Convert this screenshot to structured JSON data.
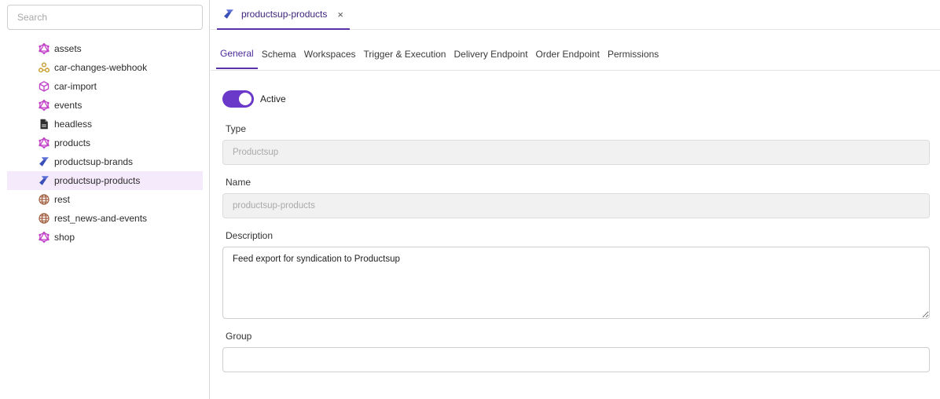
{
  "search": {
    "placeholder": "Search"
  },
  "sidebar": {
    "items": [
      {
        "label": "assets",
        "icon": "graphql-icon",
        "selected": false
      },
      {
        "label": "car-changes-webhook",
        "icon": "webhook-icon",
        "selected": false
      },
      {
        "label": "car-import",
        "icon": "cube-import-icon",
        "selected": false
      },
      {
        "label": "events",
        "icon": "graphql-icon",
        "selected": false
      },
      {
        "label": "headless",
        "icon": "document-icon",
        "selected": false
      },
      {
        "label": "products",
        "icon": "graphql-icon",
        "selected": false
      },
      {
        "label": "productsup-brands",
        "icon": "productsup-icon",
        "selected": false
      },
      {
        "label": "productsup-products",
        "icon": "productsup-icon",
        "selected": true
      },
      {
        "label": "rest",
        "icon": "globe-icon",
        "selected": false
      },
      {
        "label": "rest_news-and-events",
        "icon": "globe-icon",
        "selected": false
      },
      {
        "label": "shop",
        "icon": "graphql-icon",
        "selected": false
      }
    ]
  },
  "doc_tab": {
    "label": "productsup-products",
    "close_symbol": "×",
    "icon": "productsup-icon"
  },
  "tabs": [
    {
      "label": "General",
      "active": true
    },
    {
      "label": "Schema",
      "active": false
    },
    {
      "label": "Workspaces",
      "active": false
    },
    {
      "label": "Trigger & Execution",
      "active": false
    },
    {
      "label": "Delivery Endpoint",
      "active": false
    },
    {
      "label": "Order Endpoint",
      "active": false
    },
    {
      "label": "Permissions",
      "active": false
    }
  ],
  "form": {
    "active_label": "Active",
    "active_on": true,
    "type_label": "Type",
    "type_value": "Productsup",
    "name_label": "Name",
    "name_value": "productsup-products",
    "description_label": "Description",
    "description_value": "Feed export for syndication to Productsup",
    "group_label": "Group",
    "group_value": ""
  },
  "colors": {
    "accent": "#6a39c9",
    "graphql": "#c13fc8",
    "webhook": "#c89a2b",
    "productsup": "#3b4fb8",
    "globe": "#a05a3a",
    "selected_bg": "#f5eafc"
  }
}
